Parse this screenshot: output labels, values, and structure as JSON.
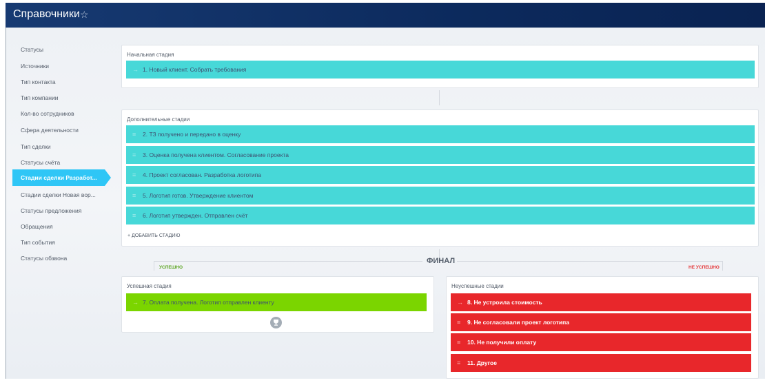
{
  "header": {
    "title": "Справочники",
    "star_icon": "star-outline-icon"
  },
  "sidebar": {
    "items": [
      {
        "label": "Статусы"
      },
      {
        "label": "Источники"
      },
      {
        "label": "Тип контакта"
      },
      {
        "label": "Тип компании"
      },
      {
        "label": "Кол-во сотрудников"
      },
      {
        "label": "Сфера деятельности"
      },
      {
        "label": "Тип сделки"
      },
      {
        "label": "Статусы счёта"
      },
      {
        "label": "Стадии сделки Разработ...",
        "active": true
      },
      {
        "label": "Стадии сделки Новая вор..."
      },
      {
        "label": "Статусы предложения"
      },
      {
        "label": "Обращения"
      },
      {
        "label": "Тип события"
      },
      {
        "label": "Статусы обзвона"
      }
    ]
  },
  "initial": {
    "label": "Начальная стадия",
    "stages": [
      {
        "label": "1. Новый клиент. Собрать требования"
      }
    ]
  },
  "additional": {
    "label": "Дополнительные стадии",
    "stages": [
      {
        "label": "2. ТЗ получено и передано в оценку"
      },
      {
        "label": "3. Оценка получена клиентом. Согласование проекта"
      },
      {
        "label": "4. Проект согласован. Разработка логотипа"
      },
      {
        "label": "5. Логотип готов. Утверждение клиентом"
      },
      {
        "label": "6. Логотип утвержден. Отправлен счёт"
      }
    ],
    "add_label": "+ ДОБАВИТЬ СТАДИЮ"
  },
  "final": {
    "title": "ФИНАЛ",
    "success_tag": "УСПЕШНО",
    "fail_tag": "НЕ УСПЕШНО",
    "success": {
      "label": "Успешная стадия",
      "stages": [
        {
          "label": "7. Оплата получена. Логотип отправлен клиенту"
        }
      ]
    },
    "fail": {
      "label": "Неуспешные стадии",
      "stages": [
        {
          "label": "8. Не устроила стоимость"
        },
        {
          "label": "9. Не согласовали проект логотипа"
        },
        {
          "label": "10. Не получили оплату"
        },
        {
          "label": "11. Другое"
        }
      ]
    }
  },
  "colors": {
    "header": "#0c2a5d",
    "active_item": "#2fc6f6",
    "stage_cyan": "#47d8d8",
    "stage_success": "#7bd500",
    "stage_fail": "#e8272b"
  }
}
